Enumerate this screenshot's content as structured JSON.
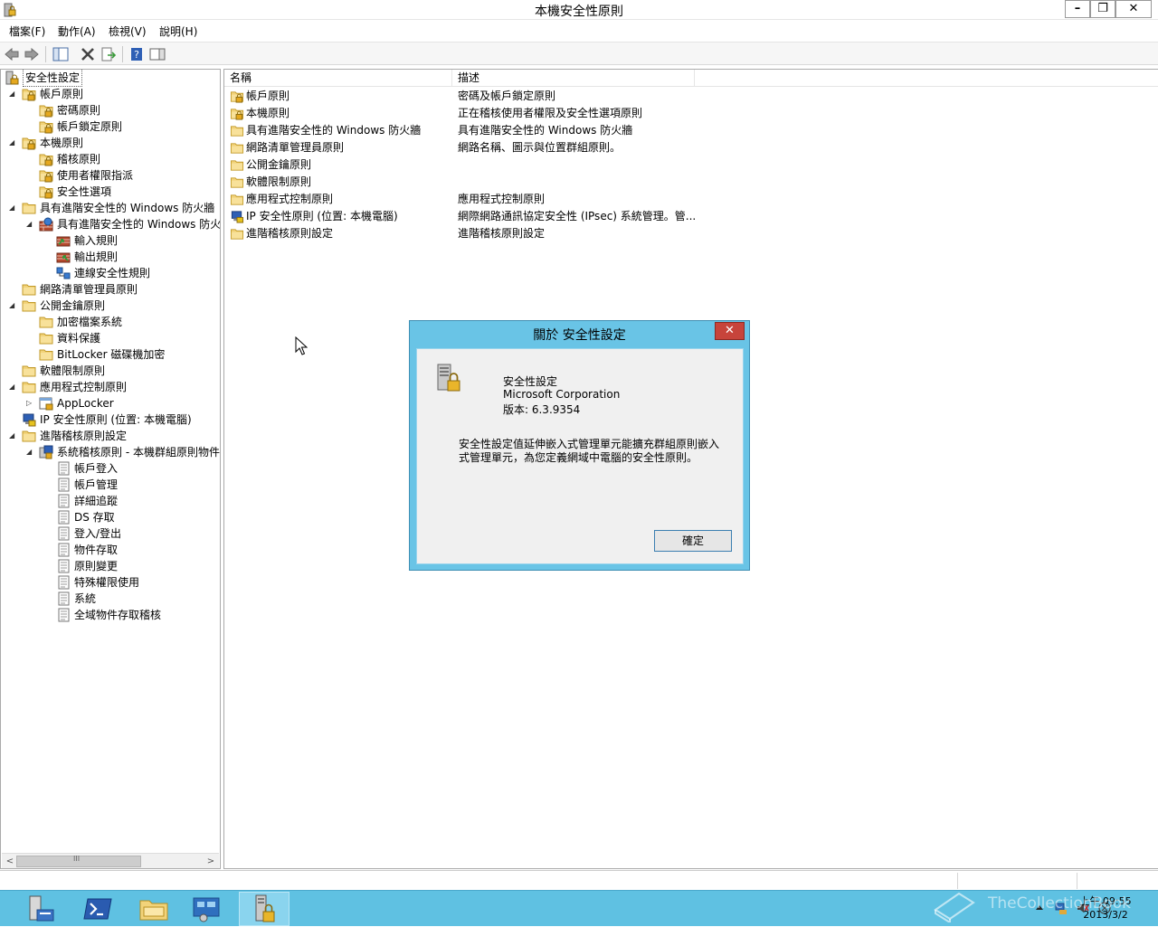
{
  "window": {
    "title": "本機安全性原則",
    "minimize": "–",
    "restore": "❐",
    "close": "✕"
  },
  "menu": [
    "檔案(F)",
    "動作(A)",
    "檢視(V)",
    "說明(H)"
  ],
  "toolbar": [
    "back-icon",
    "forward-icon",
    "show-hide-tree-icon",
    "delete-icon",
    "export-icon",
    "help-icon",
    "action-pane-icon"
  ],
  "tree": [
    {
      "label": "安全性設定",
      "icon": "security-settings-icon"
    },
    {
      "label": "帳戶原則",
      "icon": "folder-lock-icon"
    },
    {
      "label": "密碼原則",
      "icon": "folder-lock-icon"
    },
    {
      "label": "帳戶鎖定原則",
      "icon": "folder-lock-icon"
    },
    {
      "label": "本機原則",
      "icon": "folder-lock-icon"
    },
    {
      "label": "稽核原則",
      "icon": "folder-lock-icon"
    },
    {
      "label": "使用者權限指派",
      "icon": "folder-lock-icon"
    },
    {
      "label": "安全性選項",
      "icon": "folder-lock-icon"
    },
    {
      "label": "具有進階安全性的 Windows 防火牆",
      "icon": "folder-icon"
    },
    {
      "label": "具有進階安全性的 Windows 防火",
      "icon": "firewall-icon"
    },
    {
      "label": "輸入規則",
      "icon": "inbound-rules-icon"
    },
    {
      "label": "輸出規則",
      "icon": "outbound-rules-icon"
    },
    {
      "label": "連線安全性規則",
      "icon": "connection-security-icon"
    },
    {
      "label": "網路清單管理員原則",
      "icon": "folder-icon"
    },
    {
      "label": "公開金鑰原則",
      "icon": "folder-icon"
    },
    {
      "label": "加密檔案系統",
      "icon": "folder-icon"
    },
    {
      "label": "資料保護",
      "icon": "folder-icon"
    },
    {
      "label": "BitLocker 磁碟機加密",
      "icon": "folder-icon"
    },
    {
      "label": "軟體限制原則",
      "icon": "folder-icon"
    },
    {
      "label": "應用程式控制原則",
      "icon": "folder-icon"
    },
    {
      "label": "AppLocker",
      "icon": "applocker-icon"
    },
    {
      "label": "IP 安全性原則 (位置: 本機電腦)",
      "icon": "ip-security-icon"
    },
    {
      "label": "進階稽核原則設定",
      "icon": "folder-icon"
    },
    {
      "label": "系統稽核原則 - 本機群組原則物件",
      "icon": "audit-policy-icon"
    },
    {
      "label": "帳戶登入",
      "icon": "policy-page-icon"
    },
    {
      "label": "帳戶管理",
      "icon": "policy-page-icon"
    },
    {
      "label": "詳細追蹤",
      "icon": "policy-page-icon"
    },
    {
      "label": "DS 存取",
      "icon": "policy-page-icon"
    },
    {
      "label": "登入/登出",
      "icon": "policy-page-icon"
    },
    {
      "label": "物件存取",
      "icon": "policy-page-icon"
    },
    {
      "label": "原則變更",
      "icon": "policy-page-icon"
    },
    {
      "label": "特殊權限使用",
      "icon": "policy-page-icon"
    },
    {
      "label": "系統",
      "icon": "policy-page-icon"
    },
    {
      "label": "全域物件存取稽核",
      "icon": "policy-page-icon"
    }
  ],
  "tree_scroll": {
    "left": "<",
    "right": ">",
    "grip": "III"
  },
  "list": {
    "columns": [
      "名稱",
      "描述"
    ],
    "rows": [
      {
        "name": "帳戶原則",
        "desc": "密碼及帳戶鎖定原則",
        "icon": "folder-lock-icon"
      },
      {
        "name": "本機原則",
        "desc": "正在稽核使用者權限及安全性選項原則",
        "icon": "folder-lock-icon"
      },
      {
        "name": "具有進階安全性的 Windows 防火牆",
        "desc": "具有進階安全性的 Windows 防火牆",
        "icon": "folder-icon"
      },
      {
        "name": "網路清單管理員原則",
        "desc": "網路名稱、圖示與位置群組原則。",
        "icon": "folder-icon"
      },
      {
        "name": "公開金鑰原則",
        "desc": "",
        "icon": "folder-icon"
      },
      {
        "name": "軟體限制原則",
        "desc": "",
        "icon": "folder-icon"
      },
      {
        "name": "應用程式控制原則",
        "desc": "應用程式控制原則",
        "icon": "folder-icon"
      },
      {
        "name": "IP 安全性原則 (位置: 本機電腦)",
        "desc": "網際網路通訊協定安全性 (IPsec) 系統管理。管...",
        "icon": "ip-security-icon"
      },
      {
        "name": "進階稽核原則設定",
        "desc": "進階稽核原則設定",
        "icon": "folder-icon"
      }
    ]
  },
  "dialog": {
    "title": "關於 安全性設定",
    "close": "✕",
    "product": "安全性設定",
    "company": "Microsoft Corporation",
    "version": "版本: 6.3.9354",
    "description": "安全性設定值延伸嵌入式管理單元能擴充群組原則嵌入式管理單元，為您定義網域中電腦的安全性原則。",
    "ok": "確定"
  },
  "taskbar": {
    "apps": [
      "server-manager-icon",
      "powershell-icon",
      "file-explorer-icon",
      "control-panel-icon",
      "local-security-policy-icon"
    ],
    "tray": [
      "tray-arrow-icon",
      "network-icon",
      "volume-icon",
      "action-center-icon"
    ],
    "clock_time": "上午 09:55",
    "clock_date": "2013/3/2"
  },
  "watermark": "TheCollectionBook",
  "colors": {
    "taskbar": "#5fc1e2",
    "dialog_frame": "#69c4e6",
    "dialog_close": "#c7443b",
    "folder": "#f2d37a"
  }
}
